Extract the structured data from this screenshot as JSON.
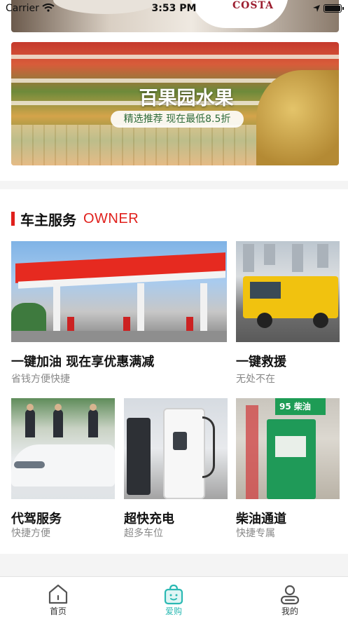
{
  "status_bar": {
    "carrier": "Carrier",
    "time": "3:53 PM"
  },
  "top_banner": {
    "brand_text": "COSTA"
  },
  "fruit_banner": {
    "title": "百果园水果",
    "subtitle": "精选推荐 现在最低8.5折"
  },
  "owner_section": {
    "title_cn": "车主服务",
    "title_en": "OWNER",
    "accent_color": "#e0201c",
    "services": [
      {
        "title": "一键加油 现在享优惠满减",
        "subtitle": "省钱方便快捷"
      },
      {
        "title": "一键救援",
        "subtitle": "无处不在"
      },
      {
        "title": "代驾服务",
        "subtitle": "快捷方便"
      },
      {
        "title": "超快充电",
        "subtitle": "超多车位"
      },
      {
        "title": "柴油通道",
        "subtitle": "快捷专属"
      }
    ],
    "diesel_sign": "95 柴油"
  },
  "tabbar": {
    "active_color": "#2bb9b3",
    "items": [
      {
        "label": "首页",
        "icon": "home-icon"
      },
      {
        "label": "爱购",
        "icon": "shopping-bag-icon",
        "active": true
      },
      {
        "label": "我的",
        "icon": "user-icon"
      }
    ]
  }
}
